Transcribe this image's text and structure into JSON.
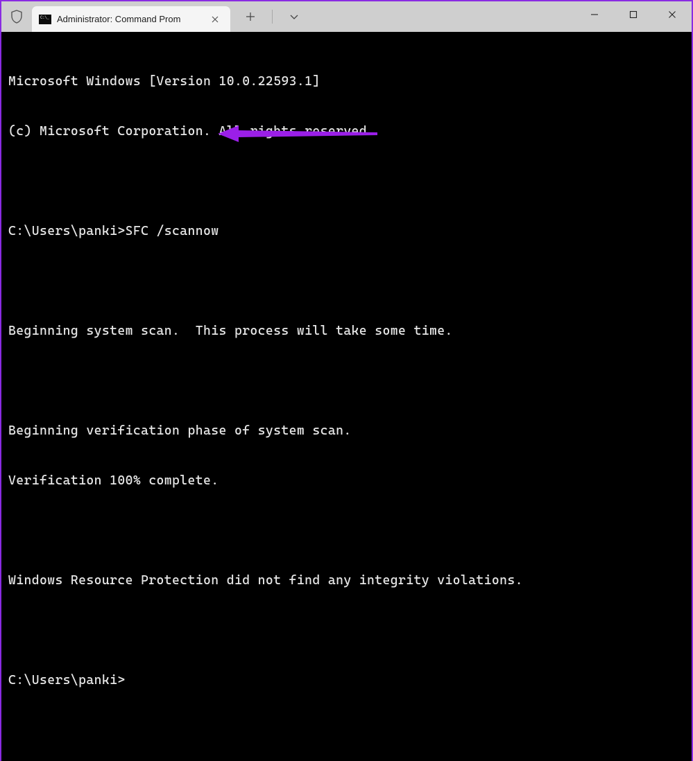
{
  "tab": {
    "title": "Administrator: Command Prom"
  },
  "terminal": {
    "lines": [
      "Microsoft Windows [Version 10.0.22593.1]",
      "(c) Microsoft Corporation. All rights reserved.",
      "",
      "C:\\Users\\panki>SFC /scannow",
      "",
      "Beginning system scan.  This process will take some time.",
      "",
      "Beginning verification phase of system scan.",
      "Verification 100% complete.",
      "",
      "Windows Resource Protection did not find any integrity violations.",
      "",
      "C:\\Users\\panki>"
    ]
  },
  "annotation": {
    "color": "#9b1fe8"
  }
}
